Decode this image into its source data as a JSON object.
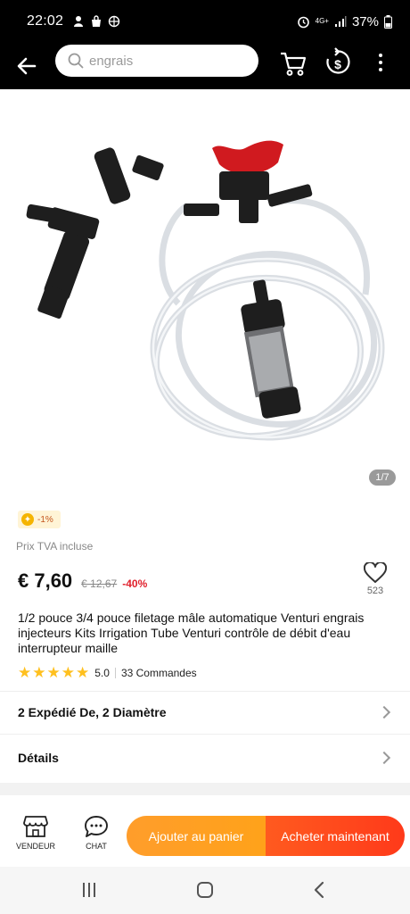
{
  "status_bar": {
    "time": "22:02",
    "network": "4G+",
    "battery": "37%"
  },
  "search": {
    "placeholder": "engrais"
  },
  "gallery": {
    "counter": "1/7"
  },
  "coin_badge": {
    "text": "-1%"
  },
  "product": {
    "tax_note": "Prix TVA incluse",
    "price": "€ 7,60",
    "old_price": "€ 12,67",
    "discount": "-40%",
    "wishlist_count": "523",
    "title": "1/2 pouce 3/4 pouce filetage mâle automatique Venturi engrais injecteurs Kits Irrigation Tube Venturi contrôle de débit d'eau interrupteur maille",
    "rating": "5.0",
    "stars": 5,
    "orders": "33 Commandes"
  },
  "rows": {
    "variants": "2 Expédié De, 2 Diamètre",
    "details": "Détails"
  },
  "bottom_bar": {
    "vendor_label": "VENDEUR",
    "chat_label": "CHAT",
    "add_to_cart": "Ajouter au panier",
    "buy_now": "Acheter maintenant"
  },
  "colors": {
    "accent_orange": "#ffa21a",
    "accent_red": "#ff3a1a",
    "star": "#ffc01e",
    "discount": "#e0202c"
  }
}
